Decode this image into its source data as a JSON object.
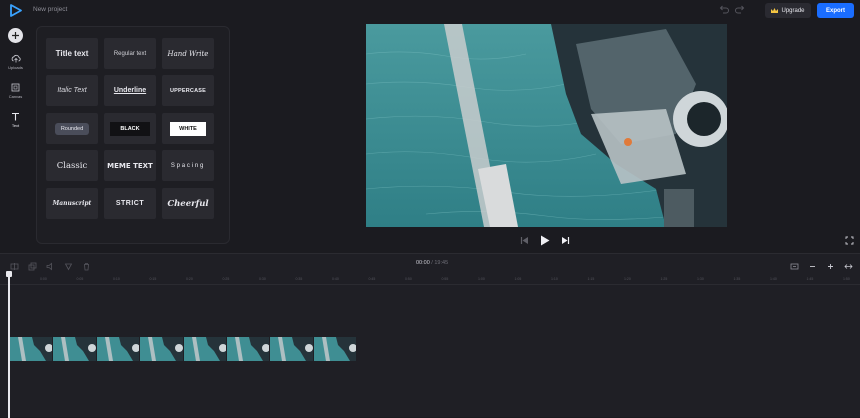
{
  "header": {
    "project_title": "New project",
    "upgrade_label": "Upgrade",
    "export_label": "Export",
    "colors": {
      "accent": "#1a6dff",
      "logo": "#3aa3ff",
      "crown": "#f4c542"
    }
  },
  "sidebar": {
    "items": [
      {
        "label": "Uploads",
        "icon": "upload-icon"
      },
      {
        "label": "Canvas",
        "icon": "canvas-icon"
      },
      {
        "label": "Text",
        "icon": "text-icon"
      }
    ]
  },
  "text_styles": [
    [
      "Title text",
      "Regular text",
      "Hand Write"
    ],
    [
      "Italic Text",
      "Underline",
      "UPPERCASE"
    ],
    [
      "Rounded",
      "BLACK",
      "WHITE"
    ],
    [
      "Classic",
      "MEME TEXT",
      "Spacing"
    ],
    [
      "Manuscript",
      "STRICT",
      "Cheerful"
    ]
  ],
  "timeline": {
    "current_time": "00:00",
    "separator": "/",
    "duration": "19:45",
    "ticks": [
      "0:00",
      "0:05",
      "0:10",
      "0:15",
      "0:20",
      "0:25",
      "0:30",
      "0:35",
      "0:40",
      "0:45",
      "0:50",
      "0:55",
      "1:00",
      "1:05",
      "1:10",
      "1:15",
      "1:20",
      "1:25",
      "1:30",
      "1:35",
      "1:40",
      "1:45",
      "1:50",
      "1:55"
    ]
  }
}
